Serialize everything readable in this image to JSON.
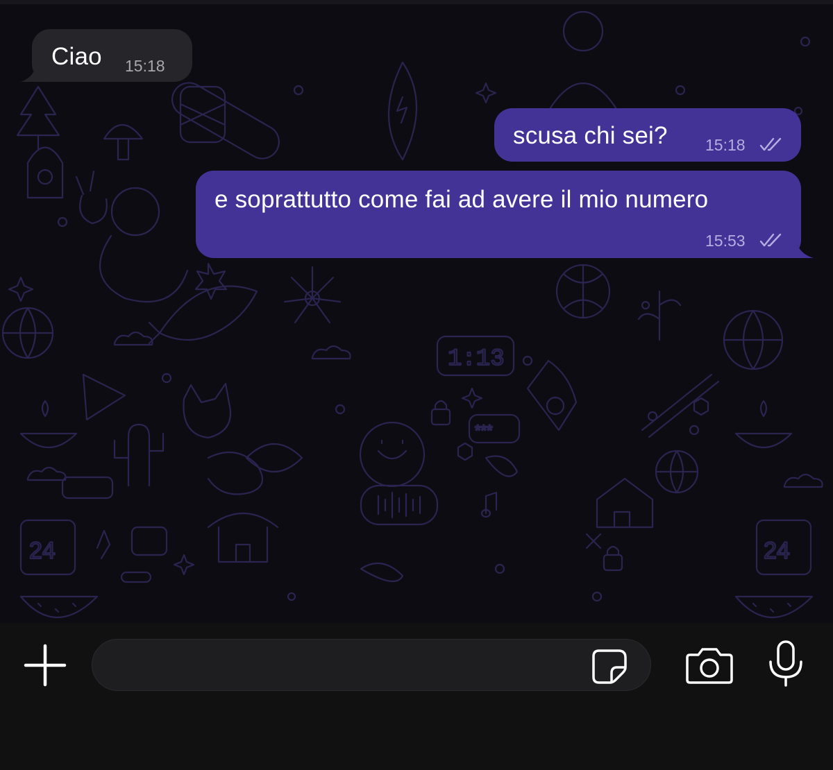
{
  "messages": [
    {
      "direction": "incoming",
      "text": "Ciao",
      "time": "15:18"
    },
    {
      "direction": "outgoing",
      "text": "scusa chi sei?",
      "time": "15:18",
      "status": "read-double-check"
    },
    {
      "direction": "outgoing",
      "text": "e soprattutto come fai ad avere il mio numero",
      "time": "15:53",
      "status": "read-double-check"
    }
  ],
  "input_bar": {
    "message_value": "",
    "icons": {
      "attach": "plus-icon",
      "sticker": "sticker-icon",
      "camera": "camera-icon",
      "voice": "microphone-icon"
    }
  },
  "colors": {
    "outgoing_bubble": "#433397",
    "incoming_bubble": "#25252a",
    "chat_background": "#0d0c12",
    "wallpaper_doodle": "#2a2450",
    "input_bar_background": "#111111"
  }
}
